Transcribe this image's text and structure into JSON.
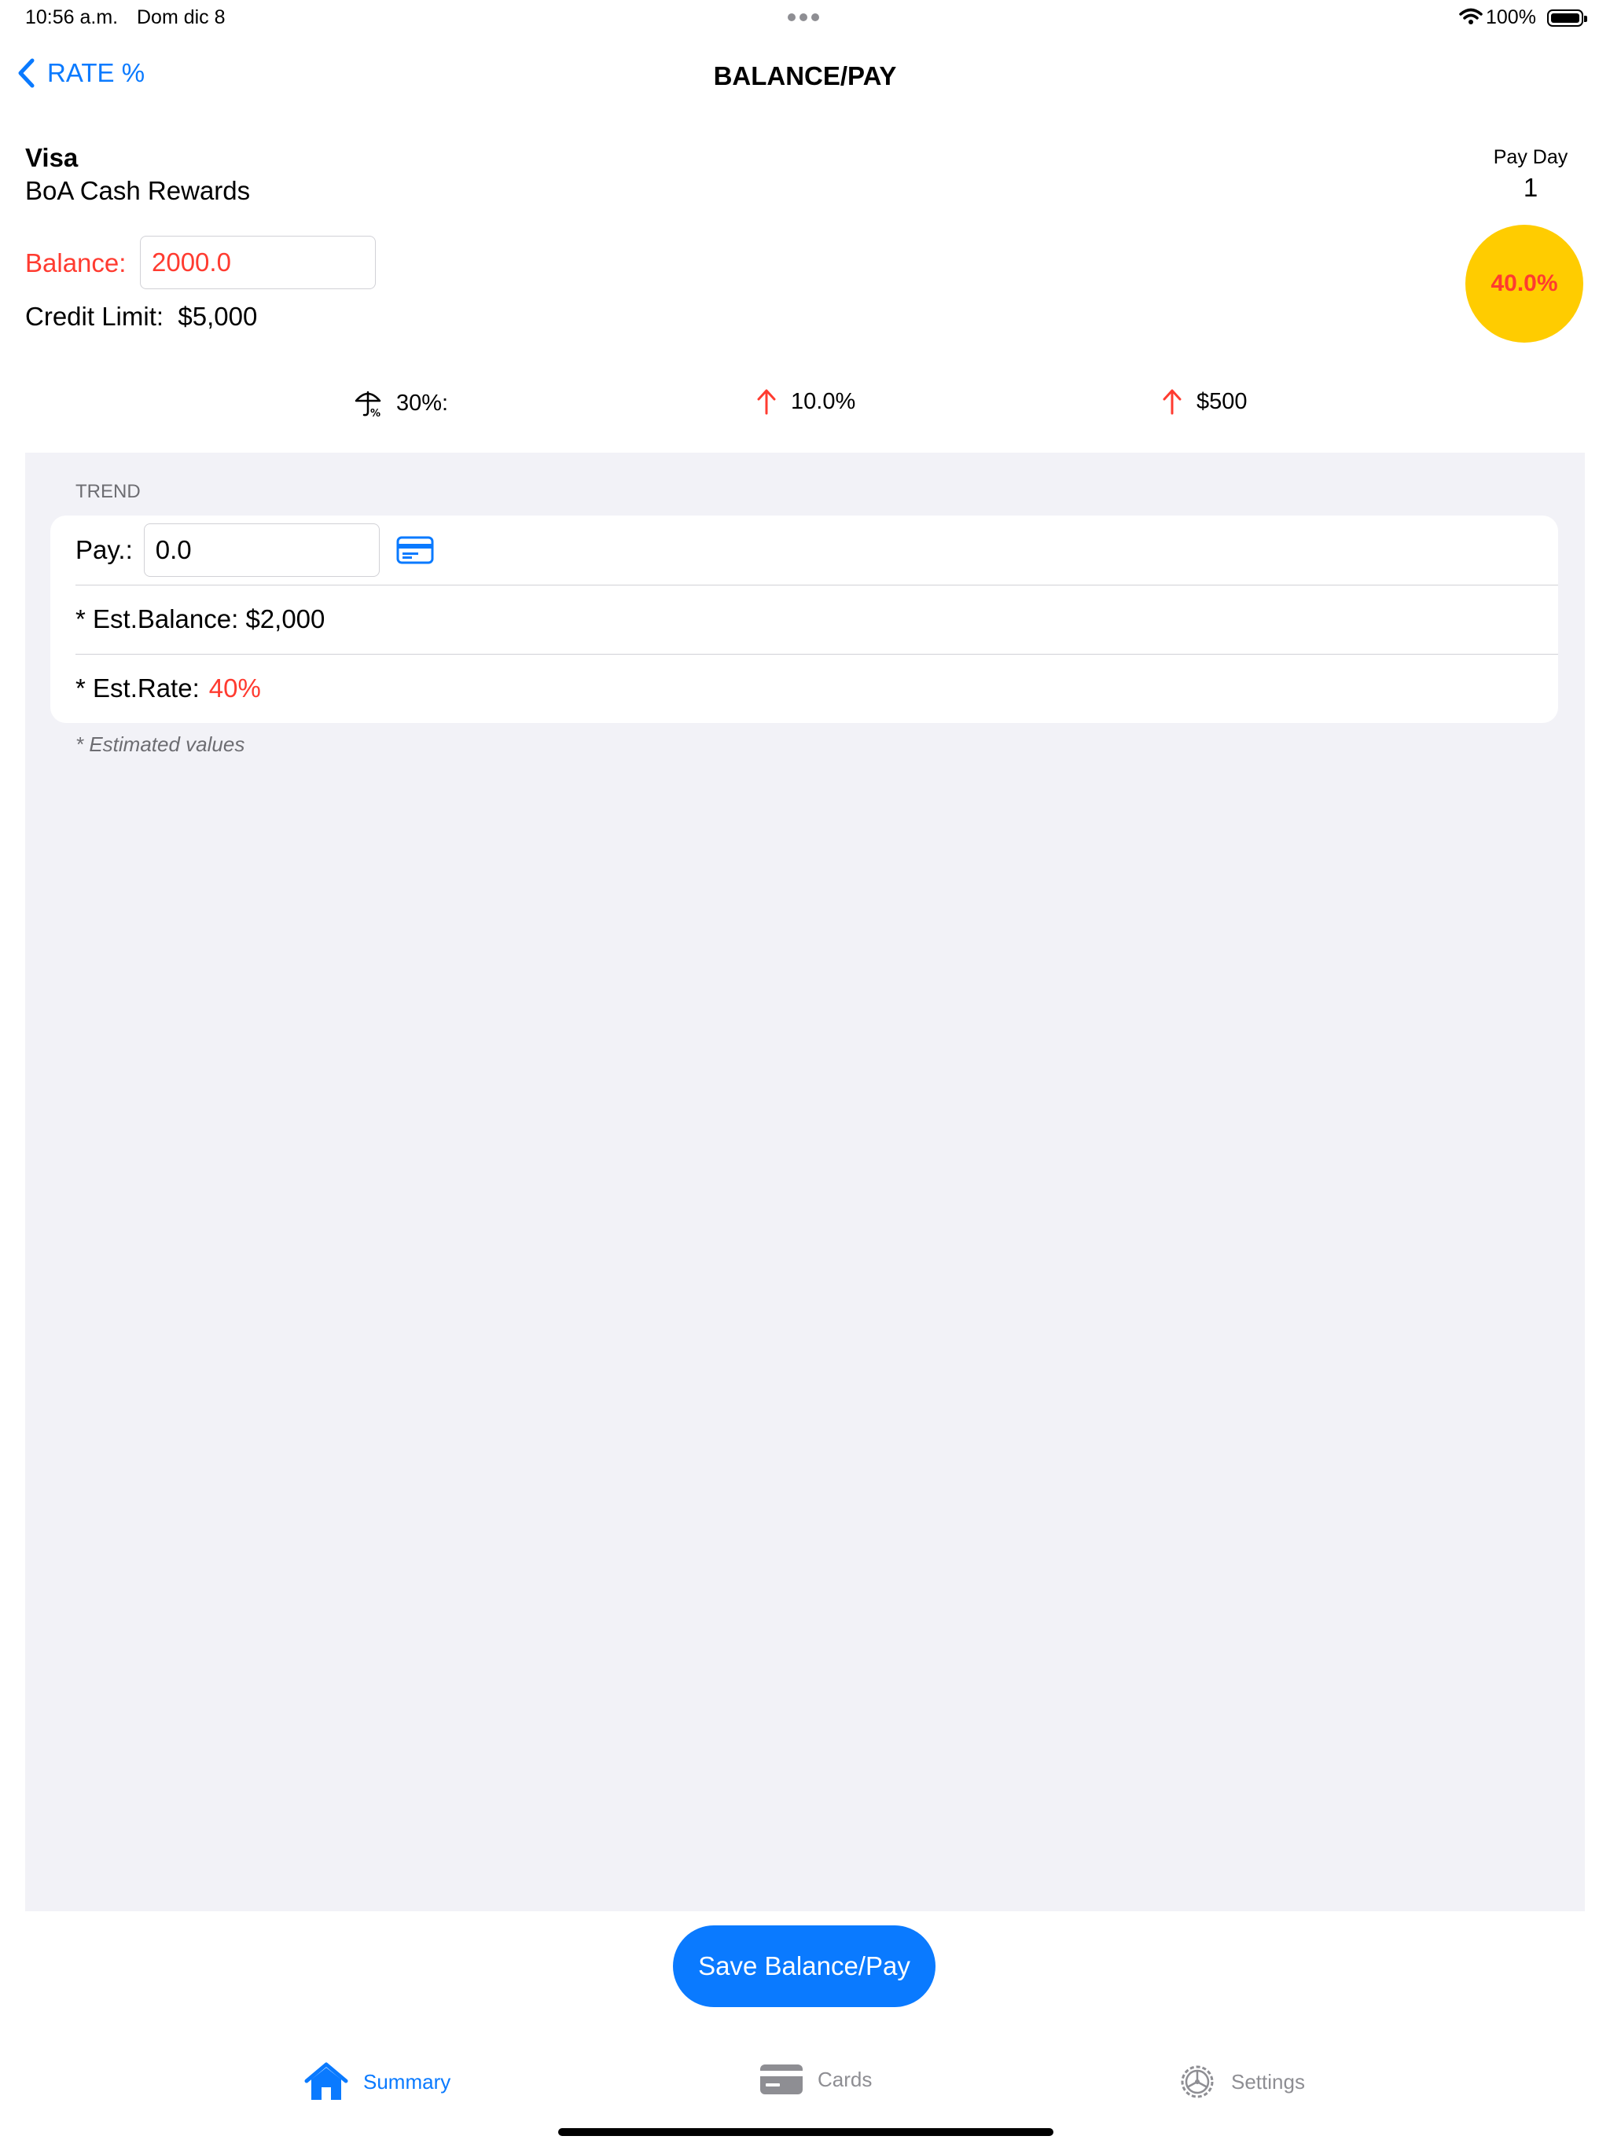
{
  "status_bar": {
    "time": "10:56 a.m.",
    "date": "Dom dic 8",
    "battery": "100%"
  },
  "nav": {
    "back_label": "RATE %",
    "title": "BALANCE/PAY"
  },
  "card": {
    "brand": "Visa",
    "name": "BoA Cash Rewards",
    "pay_day_label": "Pay Day",
    "pay_day_value": "1",
    "rate_badge": "40.0%",
    "balance_label": "Balance:",
    "balance_value": "2000.0",
    "credit_limit_label": "Credit Limit:",
    "credit_limit_value": "$5,000"
  },
  "stats": [
    {
      "label": "30%:",
      "icon": "umbrella-percent-icon"
    },
    {
      "label": "10.0%",
      "icon": "arrow-up-icon"
    },
    {
      "label": "$500",
      "icon": "arrow-up-icon"
    }
  ],
  "trend": {
    "header": "TREND",
    "pay_label": "Pay.:",
    "pay_value": "0.0",
    "est_balance_label": "* Est.Balance:",
    "est_balance_value": "$2,000",
    "est_rate_label": "* Est.Rate:",
    "est_rate_value": "40%",
    "footnote": "* Estimated values"
  },
  "save_button": "Save Balance/Pay",
  "tabs": [
    {
      "label": "Summary",
      "icon": "house-icon",
      "active": true
    },
    {
      "label": "Cards",
      "icon": "credit-card-icon",
      "active": false
    },
    {
      "label": "Settings",
      "icon": "gear-icon",
      "active": false
    }
  ],
  "colors": {
    "accent": "#0a7aff",
    "danger": "#ff3b30",
    "badge": "#ffcc00",
    "grouped_bg": "#f2f2f7"
  }
}
